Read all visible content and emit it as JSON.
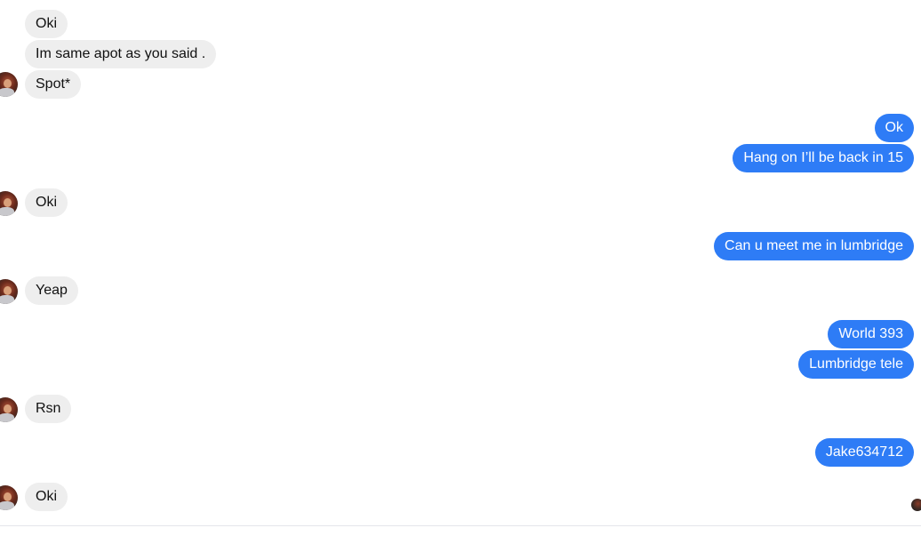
{
  "messages": [
    {
      "side": "in",
      "text": "Oki"
    },
    {
      "side": "in",
      "text": "Im same apot as you said ."
    },
    {
      "side": "in",
      "text": "Spot*"
    },
    {
      "side": "out",
      "text": "Ok"
    },
    {
      "side": "out",
      "text": "Hang on I’ll be back in 15"
    },
    {
      "side": "in",
      "text": "Oki"
    },
    {
      "side": "out",
      "text": "Can u meet me in lumbridge"
    },
    {
      "side": "in",
      "text": "Yeap"
    },
    {
      "side": "out",
      "text": "World 393"
    },
    {
      "side": "out",
      "text": "Lumbridge tele"
    },
    {
      "side": "in",
      "text": "Rsn"
    },
    {
      "side": "out",
      "text": "Jake634712"
    },
    {
      "side": "in",
      "text": "Oki"
    }
  ],
  "colors": {
    "incoming_bubble": "#eeeeee",
    "outgoing_bubble": "#2e7cf6",
    "incoming_text": "#111111",
    "outgoing_text": "#ffffff"
  }
}
